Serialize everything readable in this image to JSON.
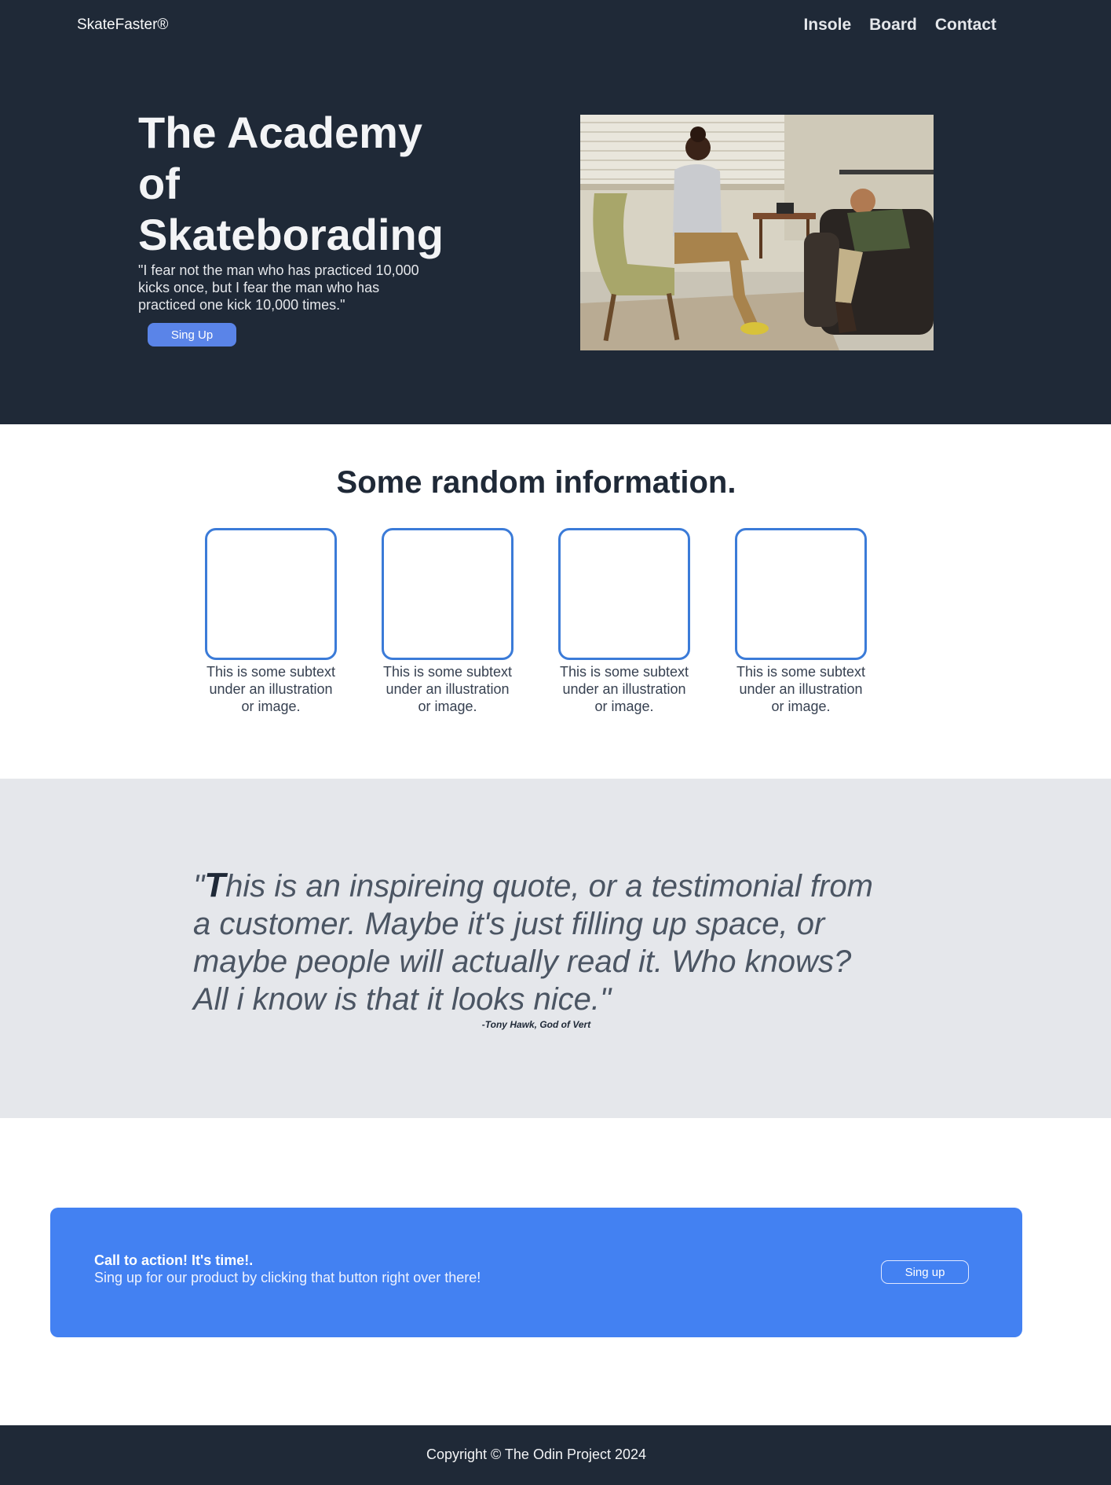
{
  "header": {
    "logo": "SkateFaster®",
    "nav": [
      "Insole",
      "Board",
      "Contact"
    ]
  },
  "hero": {
    "title": "The Academy of Skateborading",
    "quote": "\"I fear not the man who has practiced 10,000 kicks once, but I fear the man who has practiced one kick 10,000 times.\"",
    "button_label": "Sing Up"
  },
  "info": {
    "title": "Some random information.",
    "cards": [
      {
        "text": "This is some subtext under an illustration or image."
      },
      {
        "text": "This is some subtext under an illustration or image."
      },
      {
        "text": "This is some subtext under an illustration or image."
      },
      {
        "text": "This is some subtext under an illustration or image."
      }
    ]
  },
  "quote": {
    "open_mark": "\"",
    "dropcap": "T",
    "text": "his is an inspireing quote, or a testimonial from a customer. Maybe it's just filling up space, or maybe people will actually read it. Who knows? All i know is that it looks nice.\"",
    "author": "-Tony Hawk, God of Vert"
  },
  "cta": {
    "title": "Call to action! It's time!.",
    "subtitle": "Sing up for our product by clicking that button right over there!",
    "button_label": "Sing up"
  },
  "footer": {
    "text": "Copyright © The Odin Project 2024"
  },
  "colors": {
    "dark": "#1f2937",
    "accent": "#4381f2",
    "card_border": "#3b7bd8",
    "quote_bg": "#e5e7eb"
  }
}
